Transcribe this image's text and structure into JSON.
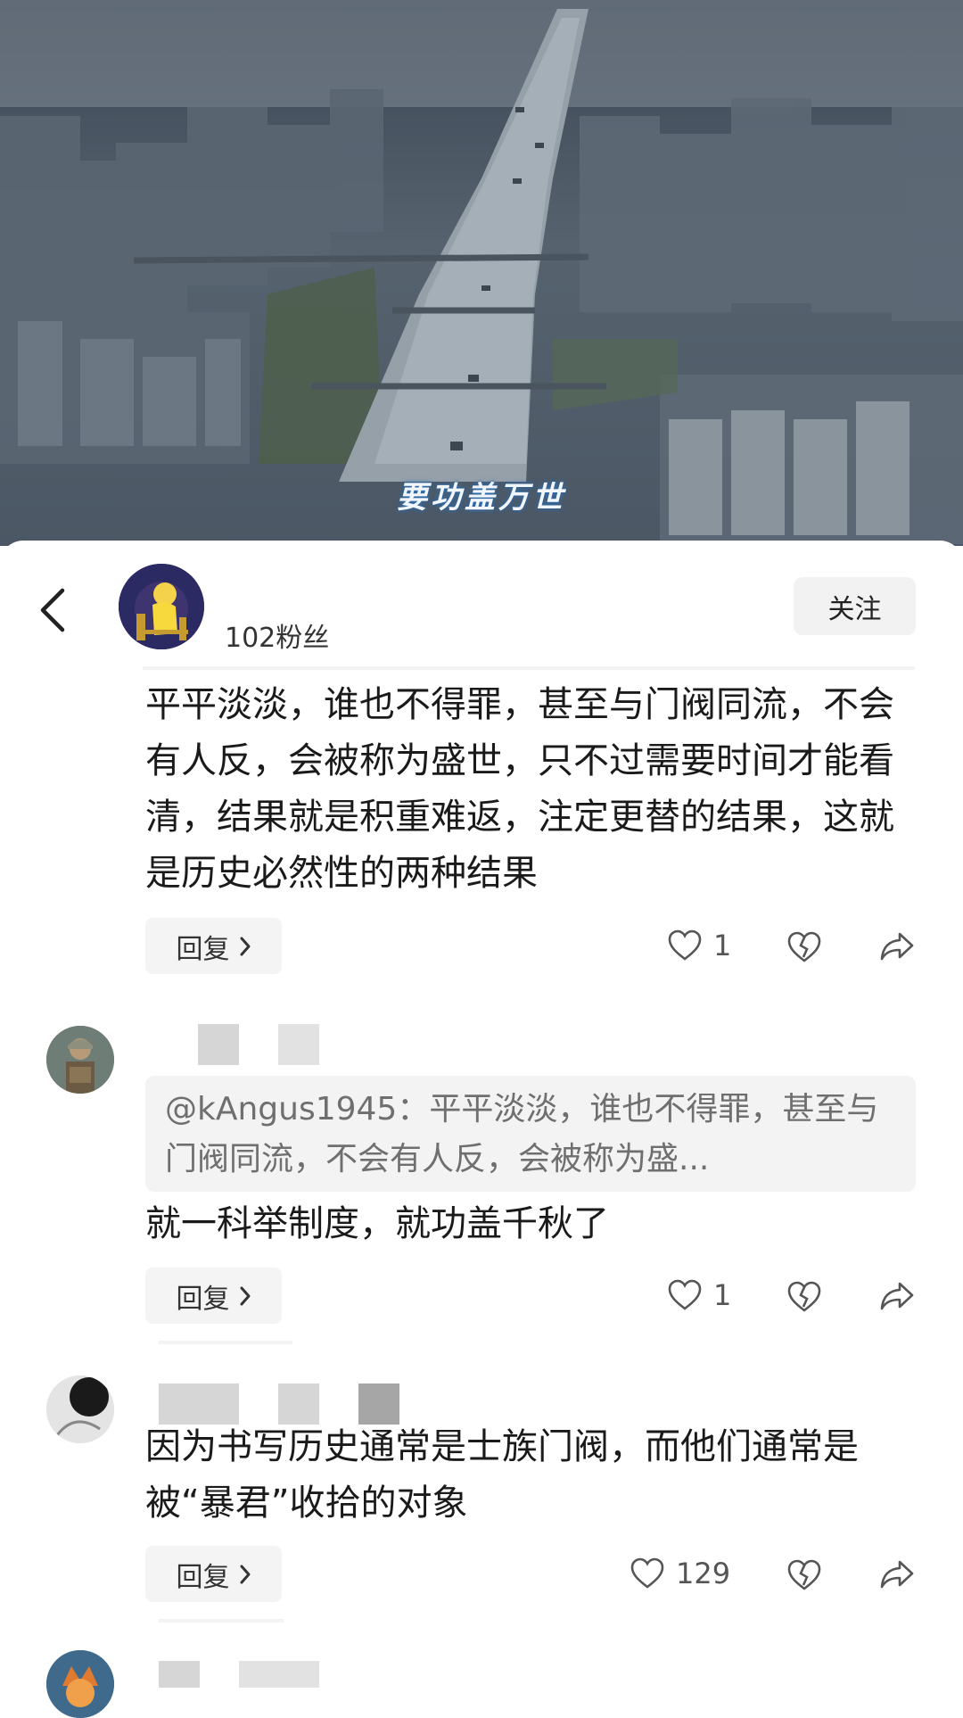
{
  "video": {
    "caption": "要功盖万世"
  },
  "header": {
    "fans": "102粉丝",
    "follow_label": "关注"
  },
  "comments": [
    {
      "text": "平平淡淡，谁也不得罪，甚至与门阀同流，不会有人反，会被称为盛世，只不过需要时间才能看清，结果就是积重难返，注定更替的结果，这就是历史必然性的两种结果",
      "reply_label": "回复",
      "likes": "1"
    },
    {
      "quote": "@kAngus1945：平平淡淡，谁也不得罪，甚至与门阀同流，不会有人反，会被称为盛...",
      "text": "就一科举制度，就功盖千秋了",
      "reply_label": "回复",
      "likes": "1"
    },
    {
      "text": "因为书写历史通常是士族门阀，而他们通常是被“暴君”收拾的对象",
      "reply_label": "回复",
      "likes": "129"
    }
  ],
  "icons": [
    "chevron-left-icon",
    "heart-icon",
    "heartbreak-icon",
    "share-icon",
    "chevron-right-icon"
  ]
}
